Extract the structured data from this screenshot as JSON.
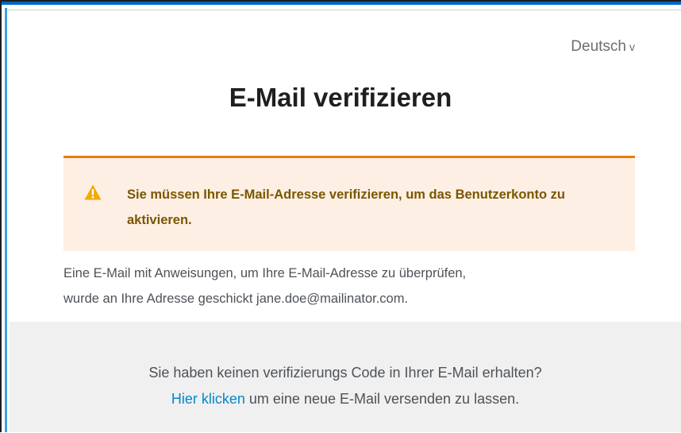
{
  "locale": {
    "current": "Deutsch",
    "chevron": "v"
  },
  "page": {
    "title": "E-Mail verifizieren"
  },
  "alert": {
    "type": "warning",
    "icon": "warning-triangle-icon",
    "icon_color": "#f0ab00",
    "accent_color": "#ec7a08",
    "message": "Sie müssen Ihre E-Mail-Adresse verifizieren, um das Benutzerkonto zu aktivieren."
  },
  "info": {
    "line1": "Eine E-Mail mit Anweisungen, um Ihre E-Mail-Adresse zu überprüfen,",
    "line2": "wurde an Ihre Adresse geschickt jane.doe@mailinator.com."
  },
  "footer": {
    "question": "Sie haben keinen verifizierungs Code in Ihrer E-Mail erhalten?",
    "link_label": "Hier klicken",
    "link_suffix": " um eine neue E-Mail versenden zu lassen."
  }
}
